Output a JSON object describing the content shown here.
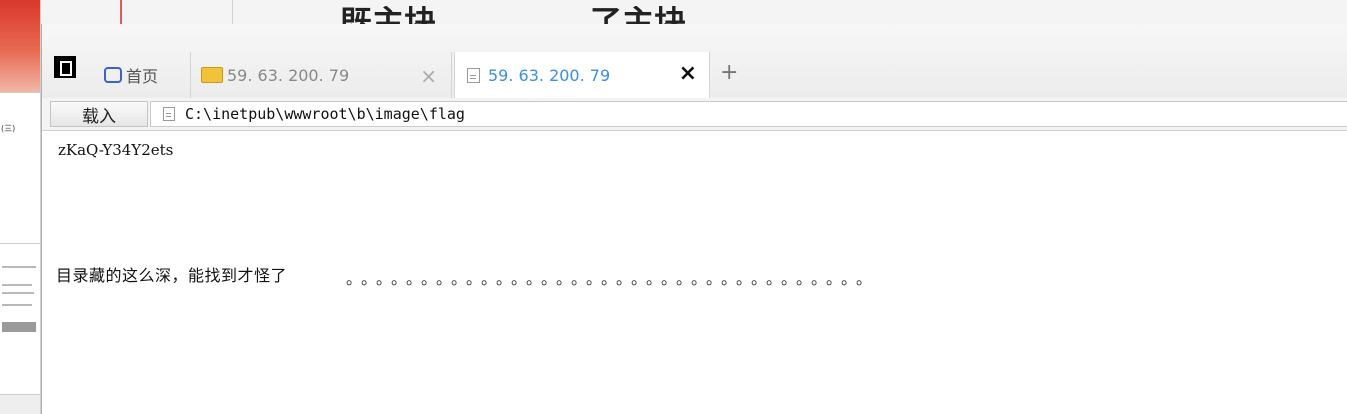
{
  "background_app": {
    "big_chars_left": "既主块",
    "big_chars_right": "了主块",
    "sidebar_note": "(三)"
  },
  "tabs": [
    {
      "label": "首页",
      "icon": "home-icon"
    },
    {
      "label": "59. 63. 200. 79",
      "icon": "folder-icon"
    },
    {
      "label": "59. 63. 200. 79",
      "icon": "page-icon",
      "active": true
    }
  ],
  "new_tab_glyph": "+",
  "close_glyph": "×",
  "address_bar": {
    "load_label": "载入",
    "url": "C:\\inetpub\\wwwroot\\b\\image\\flag"
  },
  "content": {
    "flag_text": "zKaQ-Y34Y2ets",
    "message": "目录藏的这么深，能找到才怪了",
    "dots": "。。。。。。。。。。。。。。。。。。。。。。。。。。。。。。。。。。。"
  },
  "colors": {
    "active_tab_text": "#3a8ee6",
    "folder_icon": "#f2c23a"
  }
}
